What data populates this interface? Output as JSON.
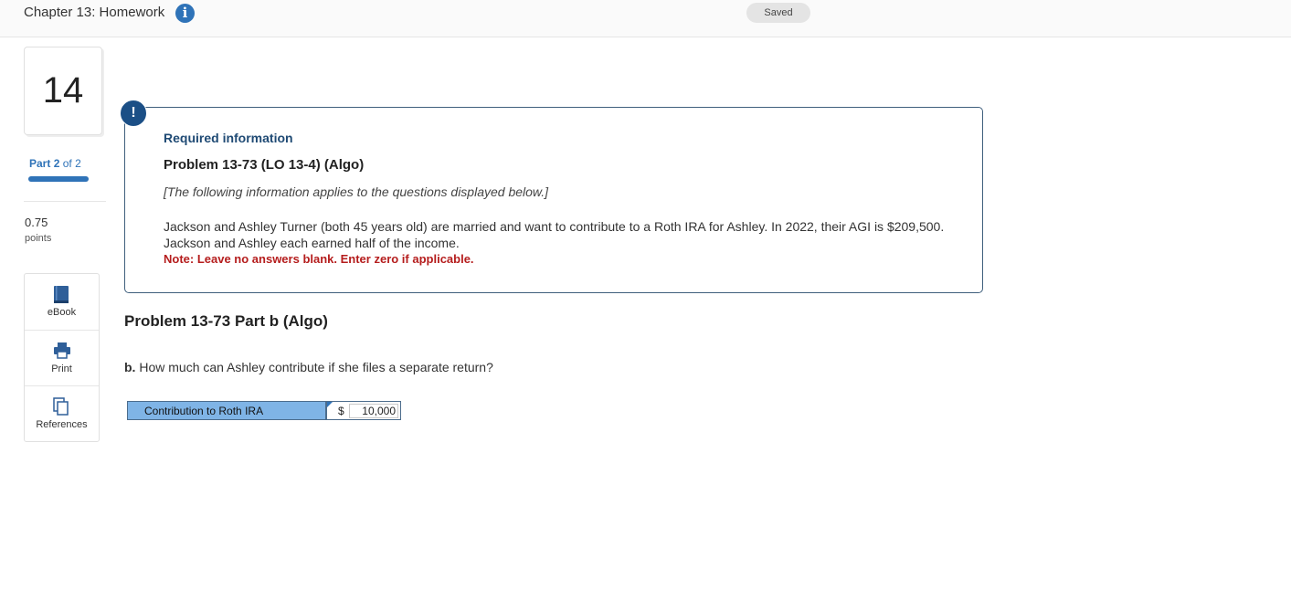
{
  "header": {
    "title": "Chapter 13: Homework",
    "save_status": "Saved"
  },
  "sidebar": {
    "question_number": "14",
    "part": {
      "word": "Part",
      "current": "2",
      "of_word": "of",
      "total": "2",
      "progress_fraction": 1.0
    },
    "points_value": "0.75",
    "points_label": "points",
    "tools": [
      {
        "label": "eBook",
        "icon": "ebook-icon"
      },
      {
        "label": "Print",
        "icon": "printer-icon"
      },
      {
        "label": "References",
        "icon": "references-icon"
      }
    ]
  },
  "required_info": {
    "badge": "!",
    "heading": "Required information",
    "problem_title": "Problem 13-73 (LO 13-4) (Algo)",
    "applies_text": "[The following information applies to the questions displayed below.]",
    "scenario": "Jackson and Ashley Turner (both 45 years old) are married and want to contribute to a Roth IRA for Ashley. In 2022, their AGI is $209,500. Jackson and Ashley each earned half of the income.",
    "note": "Note: Leave no answers blank. Enter zero if applicable."
  },
  "part_b": {
    "title": "Problem 13-73 Part b (Algo)",
    "question_letter": "b.",
    "question_text": "How much can Ashley contribute if she files a separate return?",
    "answer": {
      "label": "Contribution to Roth IRA",
      "currency": "$",
      "value": "10,000"
    }
  },
  "colors": {
    "accent": "#2f73b8",
    "note_red": "#b51d1d",
    "answer_label_bg": "#7fb4e6",
    "badge": "#1b4f86"
  }
}
